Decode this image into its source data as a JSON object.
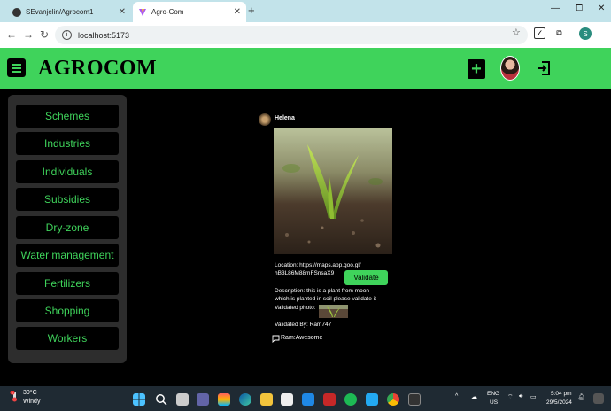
{
  "browser": {
    "tabs": [
      {
        "title": "SEvanjelin/Agrocom1",
        "close": "✕"
      },
      {
        "title": "Agro-Com",
        "close": "✕"
      }
    ],
    "new_tab": "+",
    "window_controls": {
      "minimize": "—",
      "maximize": "⧠",
      "close": "✕"
    },
    "url": "localhost:5173",
    "profile_initial": "S",
    "icons": [
      "github-icon",
      "vite-icon",
      "back-icon",
      "forward-icon",
      "reload-icon",
      "info-icon",
      "star-icon",
      "extension-icon",
      "puzzle-icon"
    ]
  },
  "app": {
    "brand": "AGROCOM",
    "accent_color": "#3fd35b",
    "add_button_label": "+",
    "sidebar": {
      "items": [
        {
          "label": "Schemes"
        },
        {
          "label": "Industries"
        },
        {
          "label": "Individuals"
        },
        {
          "label": "Subsidies"
        },
        {
          "label": "Dry-zone"
        },
        {
          "label": "Water management"
        },
        {
          "label": "Fertilizers"
        },
        {
          "label": "Shopping"
        },
        {
          "label": "Workers"
        }
      ]
    },
    "post": {
      "username": "Helena",
      "location_line1": "Location: https://maps.app.goo.gl/",
      "location_line2": "hB3L86M88mFSnsaX9",
      "validate_label": "Validate",
      "description_line1": "Description: this is a plant from moon",
      "description_line2": "which is planted in soil please validate it",
      "validated_photo_label": "Validated photo:",
      "validated_by": "Validated By: Ram747",
      "comment": "Ram:Awesome"
    }
  },
  "taskbar": {
    "weather_temp": "30°C",
    "weather_condition": "Windy",
    "weather_badge": "1",
    "lang_line1": "ENG",
    "lang_line2": "US",
    "time": "5:04 pm",
    "date": "29/5/2024",
    "tray_arrow": "^"
  }
}
